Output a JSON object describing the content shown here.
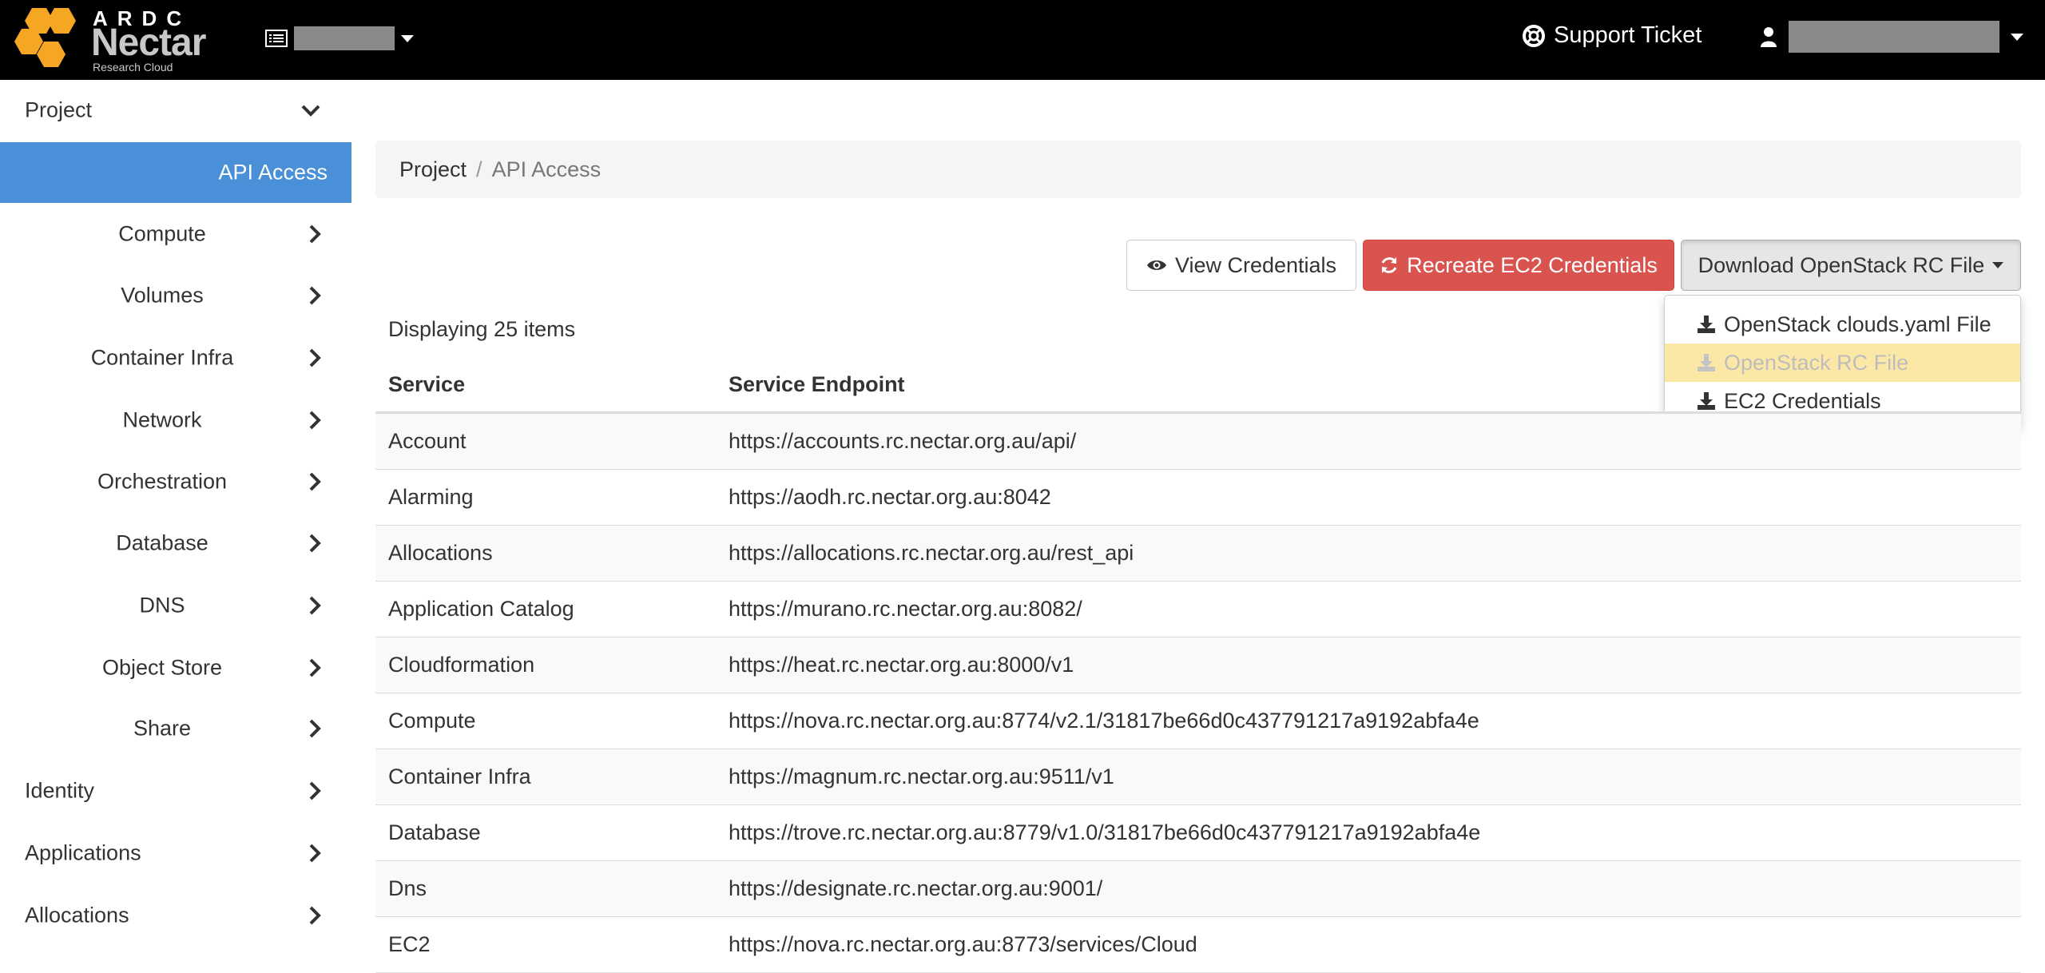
{
  "brand": {
    "top": "ARDC",
    "name": "Nectar",
    "sub": "Research Cloud"
  },
  "header": {
    "support_label": "Support Ticket"
  },
  "sidebar": {
    "project": "Project",
    "active": "API Access",
    "items": [
      "Compute",
      "Volumes",
      "Container Infra",
      "Network",
      "Orchestration",
      "Database",
      "DNS",
      "Object Store",
      "Share"
    ],
    "sections": [
      "Identity",
      "Applications",
      "Allocations"
    ]
  },
  "breadcrumb": {
    "root": "Project",
    "sep": "/",
    "current": "API Access"
  },
  "buttons": {
    "view": "View Credentials",
    "recreate": "Recreate EC2 Credentials",
    "download": "Download OpenStack RC File"
  },
  "dropdown": {
    "items": [
      {
        "label": "OpenStack clouds.yaml File",
        "disabled": false
      },
      {
        "label": "OpenStack RC File",
        "disabled": true
      },
      {
        "label": "EC2 Credentials",
        "disabled": false
      }
    ]
  },
  "table": {
    "count": "Displaying 25 items",
    "headers": [
      "Service",
      "Service Endpoint"
    ],
    "rows": [
      [
        "Account",
        "https://accounts.rc.nectar.org.au/api/"
      ],
      [
        "Alarming",
        "https://aodh.rc.nectar.org.au:8042"
      ],
      [
        "Allocations",
        "https://allocations.rc.nectar.org.au/rest_api"
      ],
      [
        "Application Catalog",
        "https://murano.rc.nectar.org.au:8082/"
      ],
      [
        "Cloudformation",
        "https://heat.rc.nectar.org.au:8000/v1"
      ],
      [
        "Compute",
        "https://nova.rc.nectar.org.au:8774/v2.1/31817be66d0c437791217a9192abfa4e"
      ],
      [
        "Container Infra",
        "https://magnum.rc.nectar.org.au:9511/v1"
      ],
      [
        "Database",
        "https://trove.rc.nectar.org.au:8779/v1.0/31817be66d0c437791217a9192abfa4e"
      ],
      [
        "Dns",
        "https://designate.rc.nectar.org.au:9001/"
      ],
      [
        "EC2",
        "https://nova.rc.nectar.org.au:8773/services/Cloud"
      ]
    ]
  },
  "colors": {
    "active": "#4a90d9",
    "danger": "#d9534f",
    "highlight": "#fbe8a6",
    "honeycomb": "#f5a623"
  }
}
